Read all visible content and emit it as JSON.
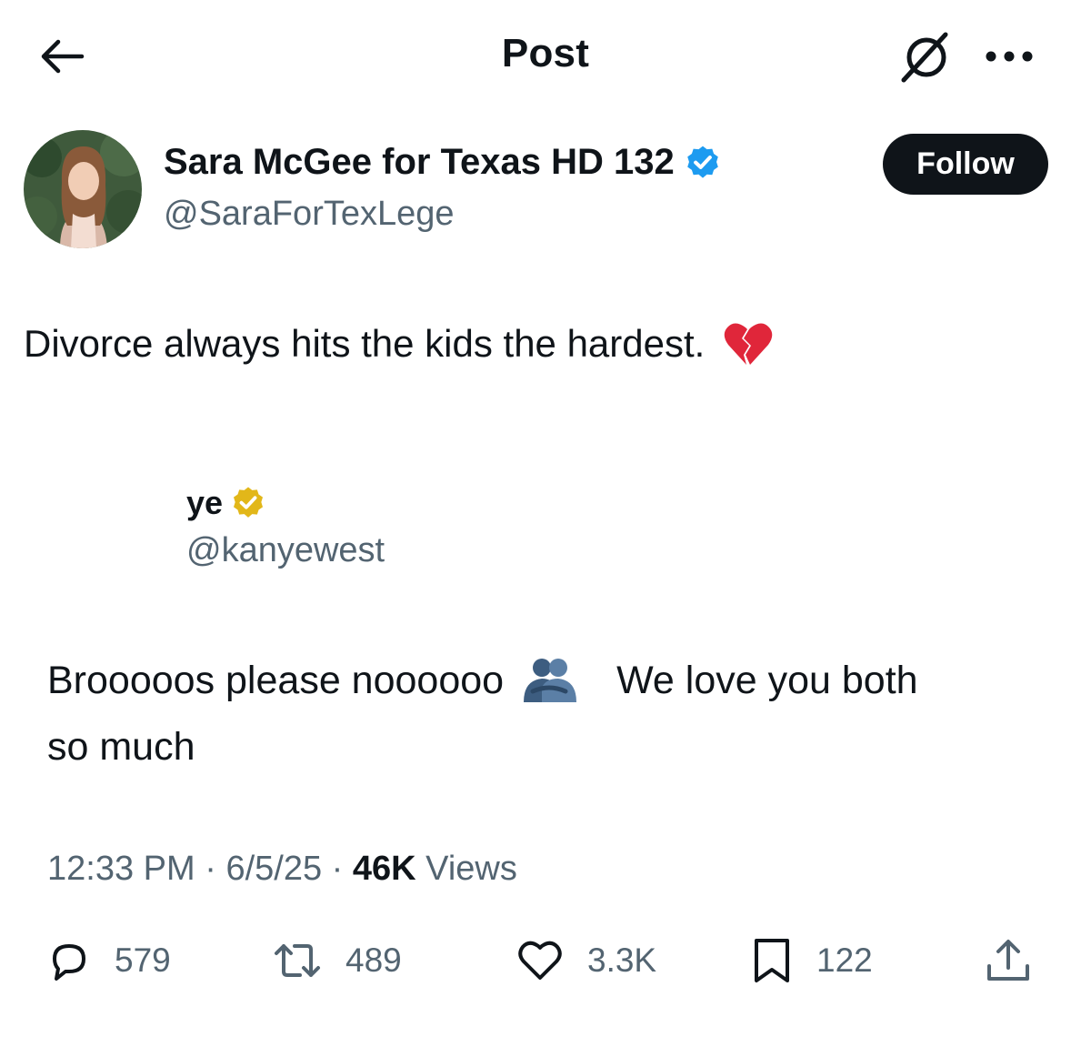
{
  "header": {
    "title": "Post",
    "back_icon": "arrow-left-icon",
    "grok_icon": "grok-icon",
    "more_icon": "more-horizontal-icon"
  },
  "author": {
    "display_name": "Sara McGee for Texas HD 132",
    "handle": "@SaraForTexLege",
    "verified": true,
    "verified_color": "#1d9bf0",
    "follow_label": "Follow"
  },
  "post": {
    "text": "Divorce always hits the kids the hardest.",
    "emoji": "broken-heart-icon"
  },
  "embedded_screenshot": {
    "name": "ye",
    "handle": "@kanyewest",
    "verified_color": "#e2b719",
    "text_line1_a": "Brooooos please noooooo",
    "text_line1_b": "We love you both",
    "text_line2": "so much",
    "emoji": "people-hugging-icon"
  },
  "meta": {
    "time": "12:33 PM",
    "date": "6/5/25",
    "views_count": "46K",
    "views_label": "Views",
    "separator": "·"
  },
  "actions": {
    "replies": "579",
    "reposts": "489",
    "likes": "3.3K",
    "bookmarks": "122"
  },
  "colors": {
    "text_primary": "#0f1419",
    "text_secondary": "#536471",
    "follow_button": "#0f1419"
  }
}
